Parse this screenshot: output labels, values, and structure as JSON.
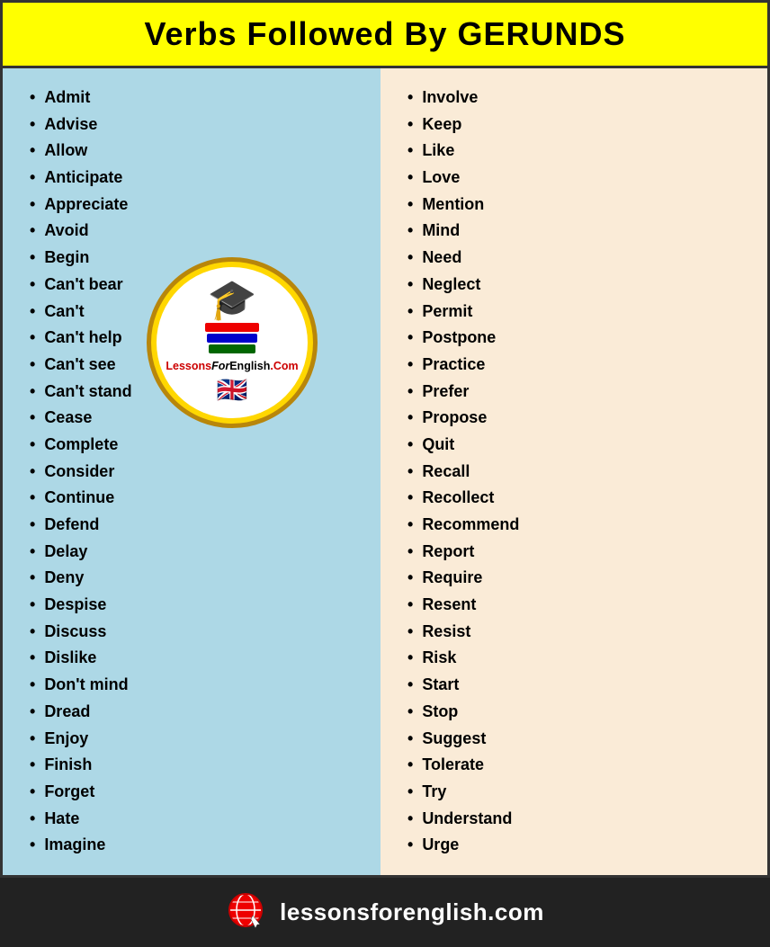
{
  "header": {
    "title": "Verbs Followed By GERUNDS"
  },
  "left_column": {
    "words": [
      "Admit",
      "Advise",
      "Allow",
      "Anticipate",
      "Appreciate",
      "Avoid",
      "Begin",
      "Can't bear",
      "Can't",
      "Can't help",
      "Can't see",
      "Can't stand",
      "Cease",
      "Complete",
      "Consider",
      "Continue",
      "Defend",
      "Delay",
      "Deny",
      "Despise",
      "Discuss",
      "Dislike",
      "Don't mind",
      "Dread",
      "Enjoy",
      "Finish",
      "Forget",
      "Hate",
      "Imagine"
    ]
  },
  "right_column": {
    "words": [
      "Involve",
      "Keep",
      "Like",
      "Love",
      "Mention",
      "Mind",
      "Need",
      "Neglect",
      "Permit",
      "Postpone",
      "Practice",
      "Prefer",
      "Propose",
      "Quit",
      "Recall",
      "Recollect",
      "Recommend",
      "Report",
      "Require",
      "Resent",
      "Resist",
      "Risk",
      "Start",
      "Stop",
      "Suggest",
      "Tolerate",
      "Try",
      "Understand",
      "Urge"
    ]
  },
  "logo": {
    "line1": "Lessons",
    "line2": "For",
    "line3": "English",
    "line4": ".Com"
  },
  "footer": {
    "website": "lessonsforenglish.com"
  }
}
